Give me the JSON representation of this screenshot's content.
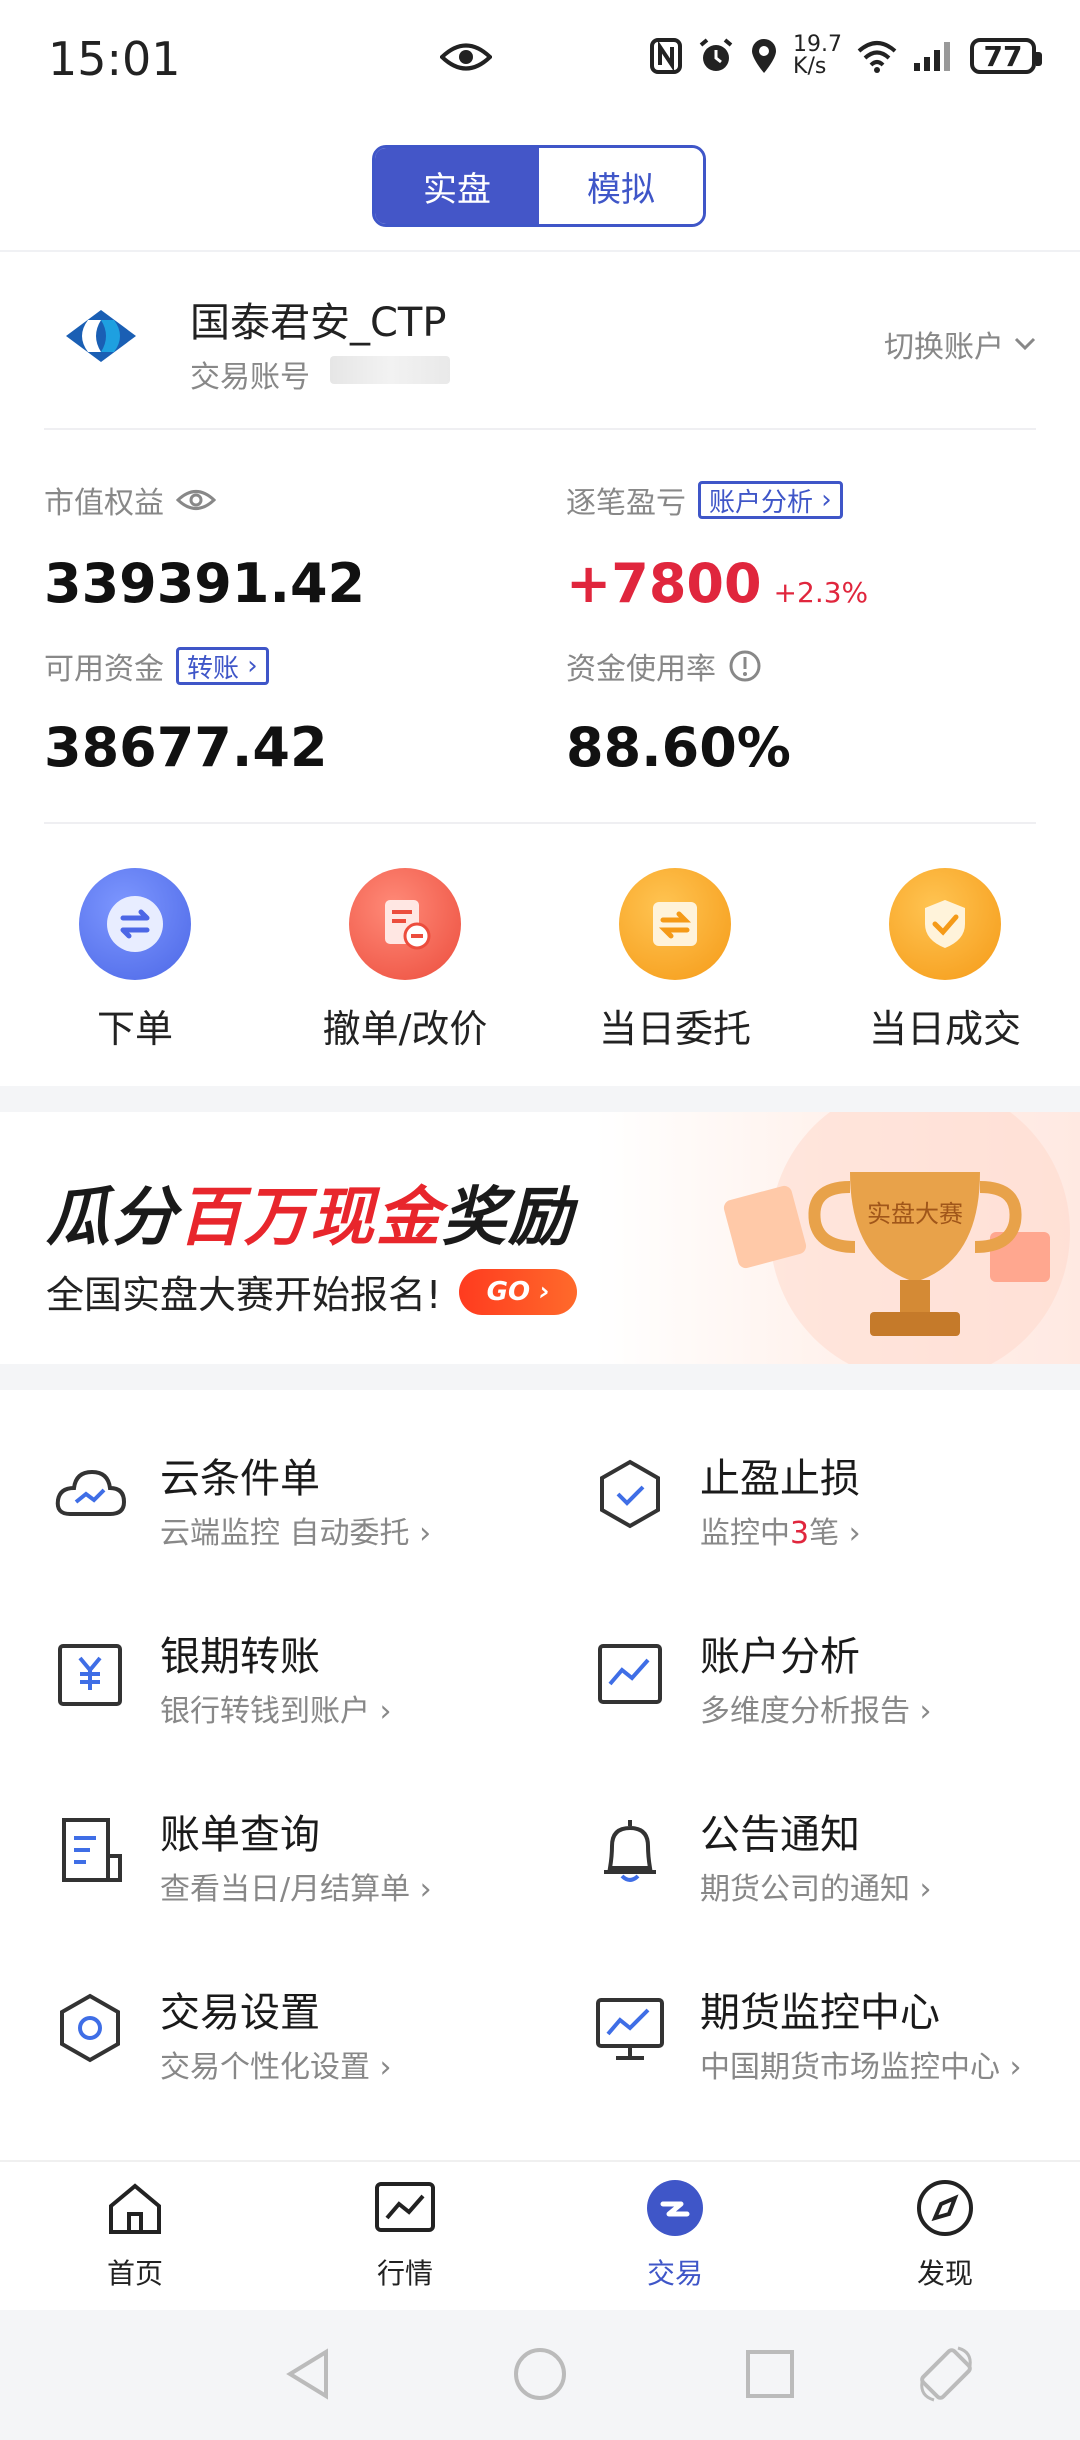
{
  "status_bar": {
    "time": "15:01",
    "net_speed_top": "19.7",
    "net_speed_unit": "K/s",
    "battery": "77"
  },
  "mode_tabs": [
    {
      "label": "实盘",
      "active": true
    },
    {
      "label": "模拟",
      "active": false
    }
  ],
  "account": {
    "name": "国泰君安_CTP",
    "id_label": "交易账号",
    "switch_label": "切换账户"
  },
  "stats": {
    "market_equity_label": "市值权益",
    "market_equity_value": "339391.42",
    "pnl_label": "逐笔盈亏",
    "pnl_analysis_btn": "账户分析",
    "pnl_value": "+7800",
    "pnl_pct": "+2.3%",
    "available_label": "可用资金",
    "transfer_btn": "转账",
    "available_value": "38677.42",
    "usage_label": "资金使用率",
    "usage_value": "88.60%"
  },
  "quick_actions": [
    {
      "label": "下单",
      "color": "#5a78f0"
    },
    {
      "label": "撤单/改价",
      "color": "#f0584a"
    },
    {
      "label": "当日委托",
      "color": "#f7a62a"
    },
    {
      "label": "当日成交",
      "color": "#f7a62a"
    }
  ],
  "banner": {
    "title_part1": "瓜分",
    "title_part2": "百万现金",
    "title_part3": "奖励",
    "subtitle": "全国实盘大赛开始报名!",
    "go_label": "GO",
    "trophy_text": "实盘大赛"
  },
  "features": [
    {
      "title": "云条件单",
      "sub": "云端监控 自动委托",
      "icon": "cloud-chart-icon"
    },
    {
      "title": "止盈止损",
      "sub_pre": "监控中",
      "sub_hl": "3",
      "sub_post": "笔",
      "icon": "shield-check-icon"
    },
    {
      "title": "银期转账",
      "sub": "银行转钱到账户",
      "icon": "yen-doc-icon"
    },
    {
      "title": "账户分析",
      "sub": "多维度分析报告",
      "icon": "chart-line-icon"
    },
    {
      "title": "账单查询",
      "sub": "查看当日/月结算单",
      "icon": "bill-icon"
    },
    {
      "title": "公告通知",
      "sub": "期货公司的通知",
      "icon": "bell-icon"
    },
    {
      "title": "交易设置",
      "sub": "交易个性化设置",
      "icon": "hexagon-gear-icon"
    },
    {
      "title": "期货监控中心",
      "sub": "中国期货市场监控中心",
      "icon": "monitor-chart-icon"
    }
  ],
  "tabs": [
    {
      "label": "首页",
      "active": false
    },
    {
      "label": "行情",
      "active": false
    },
    {
      "label": "交易",
      "active": true
    },
    {
      "label": "发现",
      "active": false
    }
  ]
}
